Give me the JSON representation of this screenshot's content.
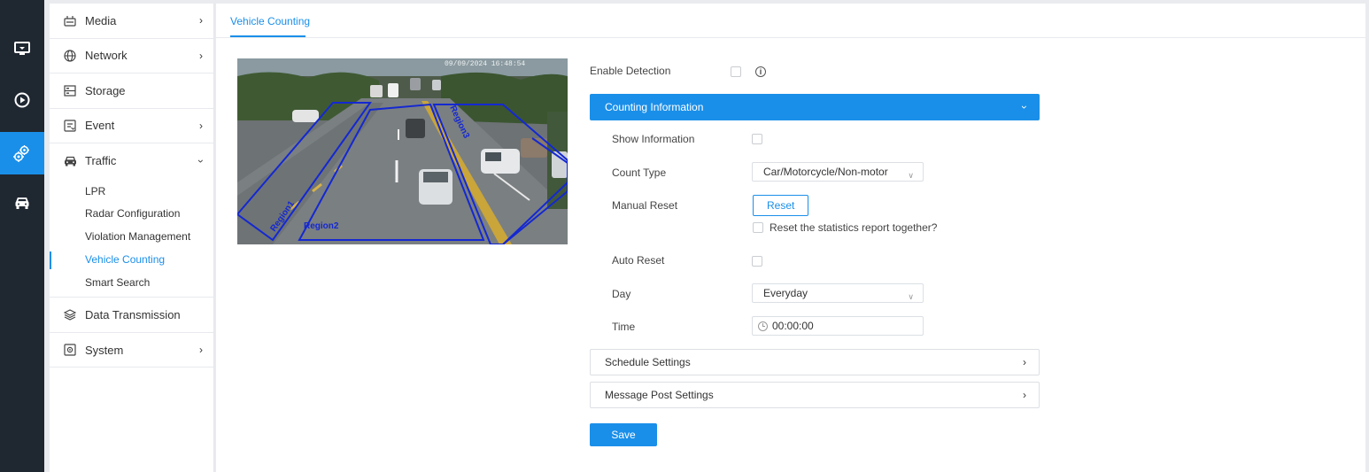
{
  "rail": {
    "items": [
      {
        "icon": "monitor-icon"
      },
      {
        "icon": "playback-icon"
      },
      {
        "icon": "settings-gears-icon"
      },
      {
        "icon": "car-icon"
      }
    ]
  },
  "sidebar": {
    "items": [
      {
        "label": "Media",
        "icon": "media-icon"
      },
      {
        "label": "Network",
        "icon": "globe-icon"
      },
      {
        "label": "Storage",
        "icon": "storage-icon"
      },
      {
        "label": "Event",
        "icon": "event-icon"
      },
      {
        "label": "Traffic",
        "icon": "car-icon"
      },
      {
        "label": "Data Transmission",
        "icon": "layers-icon"
      },
      {
        "label": "System",
        "icon": "system-icon"
      }
    ],
    "traffic_sub": [
      {
        "label": "LPR"
      },
      {
        "label": "Radar Configuration"
      },
      {
        "label": "Violation Management"
      },
      {
        "label": "Vehicle Counting"
      },
      {
        "label": "Smart Search"
      }
    ]
  },
  "tab": {
    "label": "Vehicle Counting"
  },
  "preview": {
    "timestamp": "09/09/2024 16:48:54",
    "regions": [
      "Region1",
      "Region2",
      "Region3"
    ]
  },
  "form": {
    "enable_detection": "Enable Detection",
    "counting_information": "Counting Information",
    "show_information": "Show Information",
    "count_type_label": "Count Type",
    "count_type_value": "Car/Motorcycle/Non-motor",
    "manual_reset_label": "Manual Reset",
    "reset_button": "Reset",
    "reset_report": "Reset the statistics report together?",
    "auto_reset": "Auto Reset",
    "day_label": "Day",
    "day_value": "Everyday",
    "time_label": "Time",
    "time_value": "00:00:00",
    "schedule_settings": "Schedule Settings",
    "message_post_settings": "Message Post Settings",
    "save": "Save"
  },
  "colors": {
    "accent": "#1a8fe9",
    "rail": "#1f2731",
    "region": "#1428d2"
  }
}
